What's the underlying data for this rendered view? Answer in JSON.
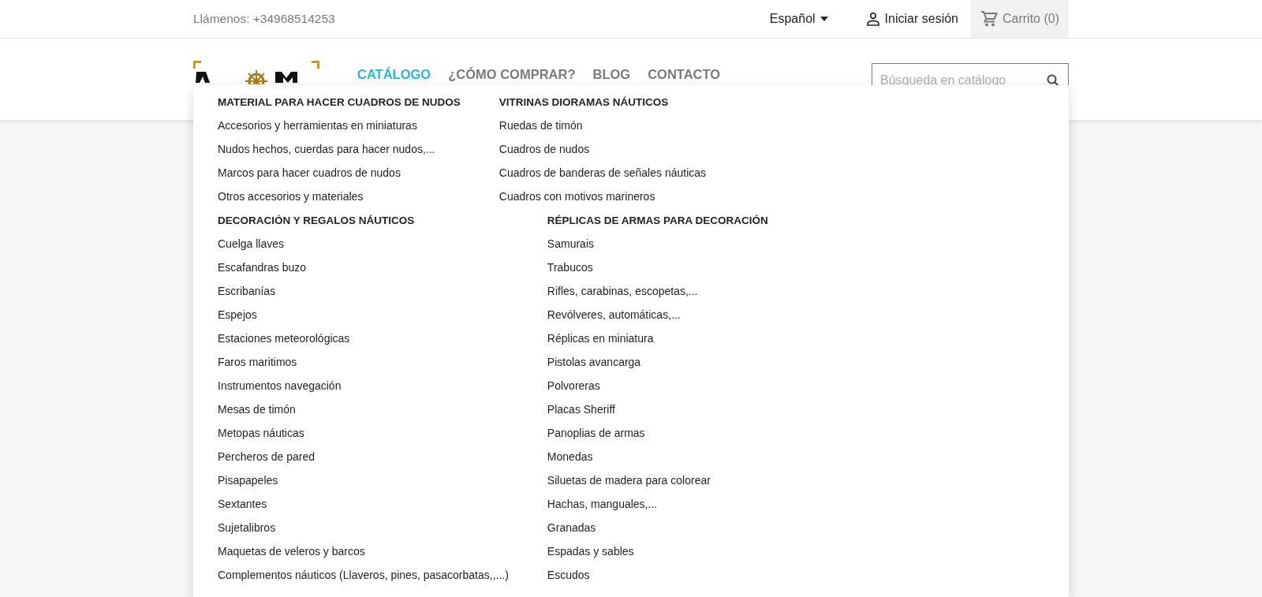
{
  "top_bar": {
    "phone": "Llámenos: +34968514253",
    "language": "Español",
    "sign_in": "Iniciar sesión",
    "cart": "Carrito (0)"
  },
  "nav": [
    {
      "label": "CATÁLOGO",
      "selected": true
    },
    {
      "label": "¿CÓMO COMPRAR?",
      "selected": false
    },
    {
      "label": "BLOG",
      "selected": false
    },
    {
      "label": "CONTACTO",
      "selected": false
    }
  ],
  "search": {
    "placeholder": "Búsqueda en catálogo"
  },
  "dropdown": [
    {
      "columns": [
        {
          "heading": "MATERIAL PARA HACER CUADROS DE NUDOS",
          "items": [
            "Accesorios y herramientas en miniaturas",
            "Nudos hechos, cuerdas para hacer nudos,...",
            "Marcos para hacer cuadros de nudos",
            "Otros accesorios y materiales"
          ]
        },
        {
          "heading": "VITRINAS DIORAMAS NÁUTICOS",
          "items": [
            "Ruedas de timón",
            "Cuadros de nudos",
            "Cuadros de banderas de señales náuticas",
            "Cuadros con motivos marineros"
          ]
        }
      ]
    },
    {
      "columns": [
        {
          "heading": "DECORACIÓN Y REGALOS NÁUTICOS",
          "items": [
            "Cuelga llaves",
            "Escafandras buzo",
            "Escribanías",
            "Espejos",
            "Estaciones meteorológicas",
            "Faros maritimos",
            "Instrumentos navegación",
            "Mesas de timón",
            "Metopas náuticas",
            "Percheros de pared",
            "Pisapapeles",
            "Sextantes",
            "Sujetalibros",
            "Maquetas de veleros y barcos",
            "Complementos náuticos (Llaveros, pines, pasacorbatas,,...)"
          ]
        },
        {
          "heading": "RÉPLICAS DE ARMAS PARA DECORACIÓN",
          "items": [
            "Samurais",
            "Trabucos",
            "Rifles, carabinas, escopetas,...",
            "Revólveres, automáticas,...",
            "Réplicas en miniatura",
            "Pistolas avancarga",
            "Polvoreras",
            "Placas Sheriff",
            "Panoplias de armas",
            "Monedas",
            "Siluetas de madera para colorear",
            "Hachas, manguales,...",
            "Granadas",
            "Espadas y sables",
            "Escudos"
          ]
        }
      ]
    }
  ]
}
